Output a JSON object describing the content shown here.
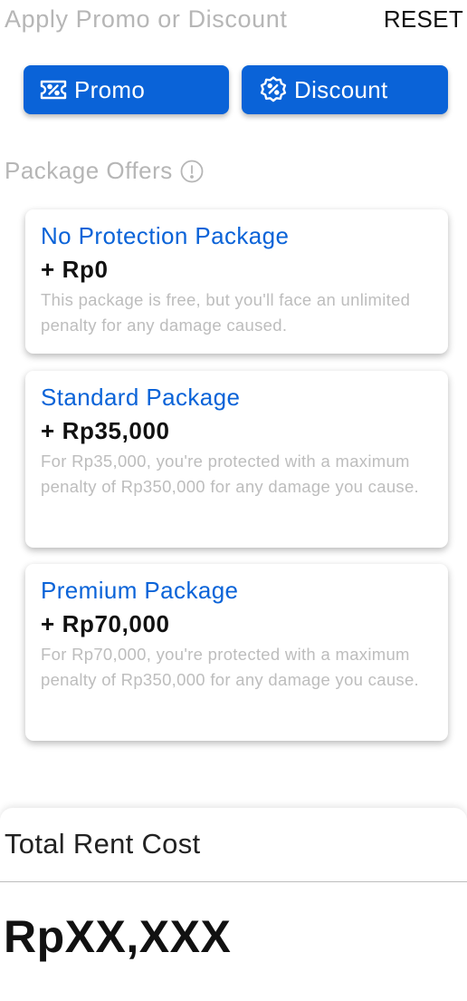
{
  "header": {
    "title": "Apply Promo or Discount",
    "reset_label": "RESET"
  },
  "buttons": {
    "promo": {
      "label": "Promo",
      "icon": "ticket-percent-icon"
    },
    "discount": {
      "label": "Discount",
      "icon": "badge-percent-icon"
    }
  },
  "offers": {
    "title": "Package Offers",
    "info_icon": "info-circle-icon",
    "packages": [
      {
        "title": "No Protection Package",
        "price": "+ Rp0",
        "description": "This package is free, but you'll face an unlimited penalty for any damage caused."
      },
      {
        "title": "Standard Package",
        "price": "+ Rp35,000",
        "description": "For Rp35,000, you're protected with a maximum penalty of Rp350,000 for any damage you cause."
      },
      {
        "title": "Premium Package",
        "price": "+ Rp70,000",
        "description": "For Rp70,000, you're protected with a maximum penalty of Rp350,000 for any damage you cause."
      }
    ]
  },
  "total": {
    "label": "Total Rent Cost",
    "amount": "RpXX,XXX"
  },
  "colors": {
    "accent": "#0a63d8",
    "muted_text": "#b6b6b6",
    "description_text": "#bdbdbd"
  }
}
